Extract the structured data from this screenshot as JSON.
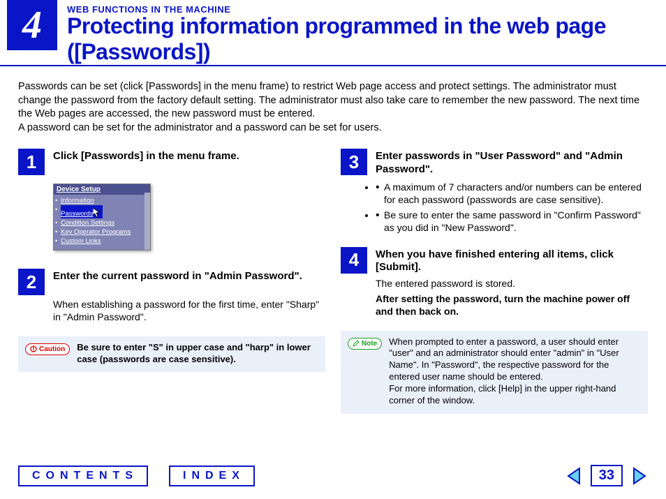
{
  "header": {
    "chapter_number": "4",
    "section_label": "WEB FUNCTIONS IN THE MACHINE",
    "page_title": "Protecting information programmed in the web page ([Passwords])"
  },
  "intro_p1": "Passwords can be set (click [Passwords] in the menu frame) to restrict Web page access and protect settings. The administrator must change the password from the factory default setting. The administrator must also take care to remember the new password. The next time the Web pages are accessed, the new password must be entered.",
  "intro_p2": "A password can be set for the administrator and a password can be set for users.",
  "device_setup": {
    "title": "Device Setup",
    "items": [
      "Information",
      "Passwords",
      "Condition Settings",
      "Key Operator Programs",
      "Custom Links"
    ]
  },
  "steps": [
    {
      "num": "1",
      "title": "Click [Passwords] in the menu frame."
    },
    {
      "num": "2",
      "title": "Enter the current password in \"Admin Password\".",
      "body": "When establishing a password for the first time, enter \"Sharp\" in \"Admin Password\"."
    },
    {
      "num": "3",
      "title": "Enter passwords in \"User Password\" and \"Admin Password\".",
      "bullets": [
        "A maximum of 7 characters and/or numbers can be entered for each password (passwords are case sensitive).",
        "Be sure to enter the same password in \"Confirm Password\" as you did in \"New Password\"."
      ]
    },
    {
      "num": "4",
      "title": "When you have finished entering all items, click [Submit].",
      "body": "The entered password is stored.",
      "body_bold": "After setting the password, turn the machine power off and then back on."
    }
  ],
  "caution": {
    "label": "Caution",
    "text": "Be sure to enter \"S\" in upper case and \"harp\" in lower case (passwords are case sensitive)."
  },
  "note": {
    "label": "Note",
    "text_p1": "When prompted to enter a password, a user should enter \"user\" and an administrator should enter \"admin\" in \"User Name\". In \"Password\", the respective password for the entered user name should be entered.",
    "text_p2": "For more information, click [Help] in the upper right-hand corner of the window."
  },
  "footer": {
    "contents": "CONTENTS",
    "index": "INDEX",
    "page_number": "33"
  }
}
